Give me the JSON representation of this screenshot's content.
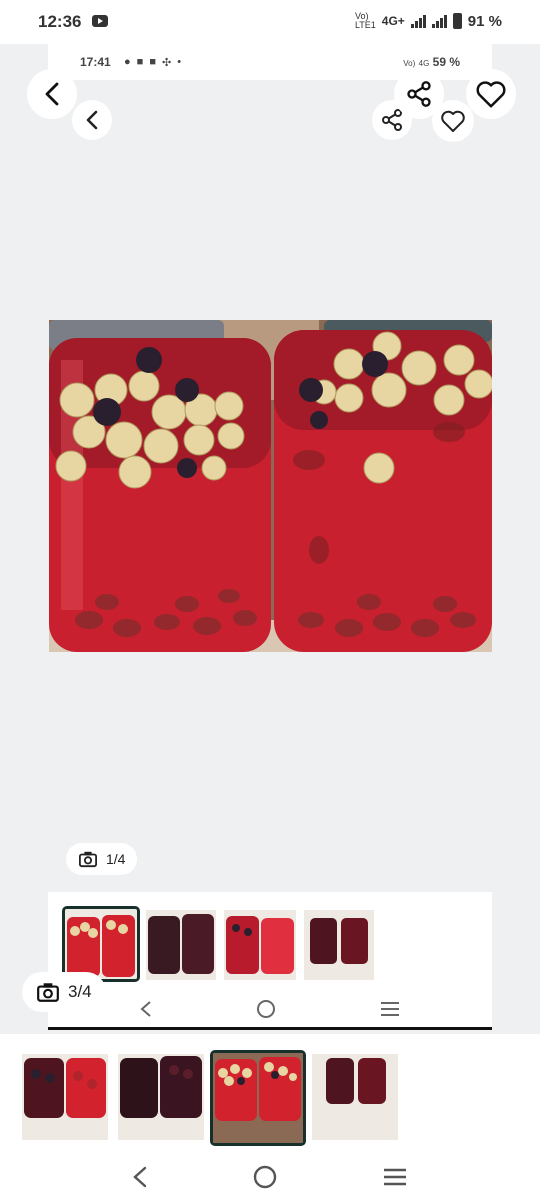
{
  "status_bar": {
    "time": "12:36",
    "network_top": "Vo)",
    "network_bottom": "LTE1",
    "network_type": "4G+",
    "battery": "91 %"
  },
  "inner_screenshot": {
    "status_time": "17:41",
    "status_network_top": "Vo)",
    "status_network_bottom": "LTE1",
    "status_network_type": "4G",
    "status_battery": "59 %",
    "photo_counter": "1/4"
  },
  "gallery": {
    "photo_counter": "3/4",
    "selected_index": 3,
    "thumbnail_count": 4
  },
  "icons": {
    "back": "back-arrow-icon",
    "share": "share-icon",
    "favorite": "heart-icon",
    "camera": "camera-icon",
    "nav_back": "nav-back-icon",
    "nav_home": "nav-home-icon",
    "nav_recents": "nav-recents-icon"
  },
  "colors": {
    "background": "#eff0f2",
    "selected_border": "#17302c",
    "compote_red": "#c8202e"
  }
}
